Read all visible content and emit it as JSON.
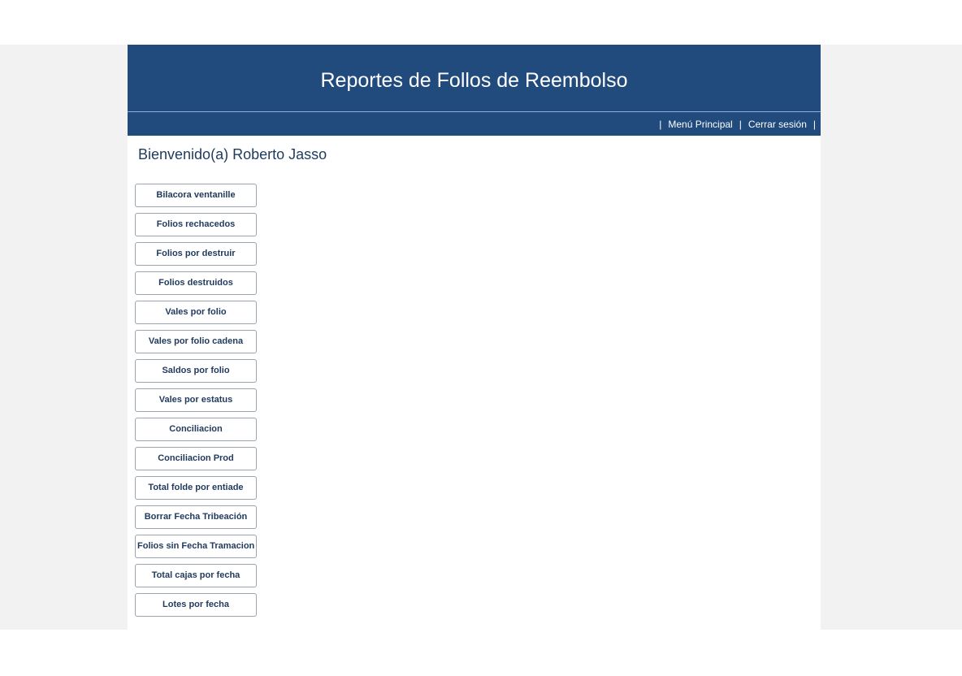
{
  "header": {
    "title": "Reportes de Follos de Reembolso"
  },
  "nav": {
    "separator": "|",
    "links": [
      "Menú Principal",
      "Cerrar sesión"
    ]
  },
  "welcome": "Bienvenido(a) Roberto Jasso",
  "menu_buttons": [
    "Bilacora ventanille",
    "Folios rechacedos",
    "Folios por destruir",
    "Folios destruidos",
    "Vales por folio",
    "Vales por folio cadena",
    "Saldos por folio",
    "Vales por estatus",
    "Conciliacion",
    "Conciliacion Prod",
    "Total folde por entiade",
    "Borrar Fecha Tribeación",
    "Folios sin Fecha Tramacion",
    "Total cajas por fecha",
    "Lotes por fecha"
  ],
  "colors": {
    "header_bg": "#214a7d",
    "text": "#1f3a5e",
    "page_bg": "#f2f2f3"
  }
}
